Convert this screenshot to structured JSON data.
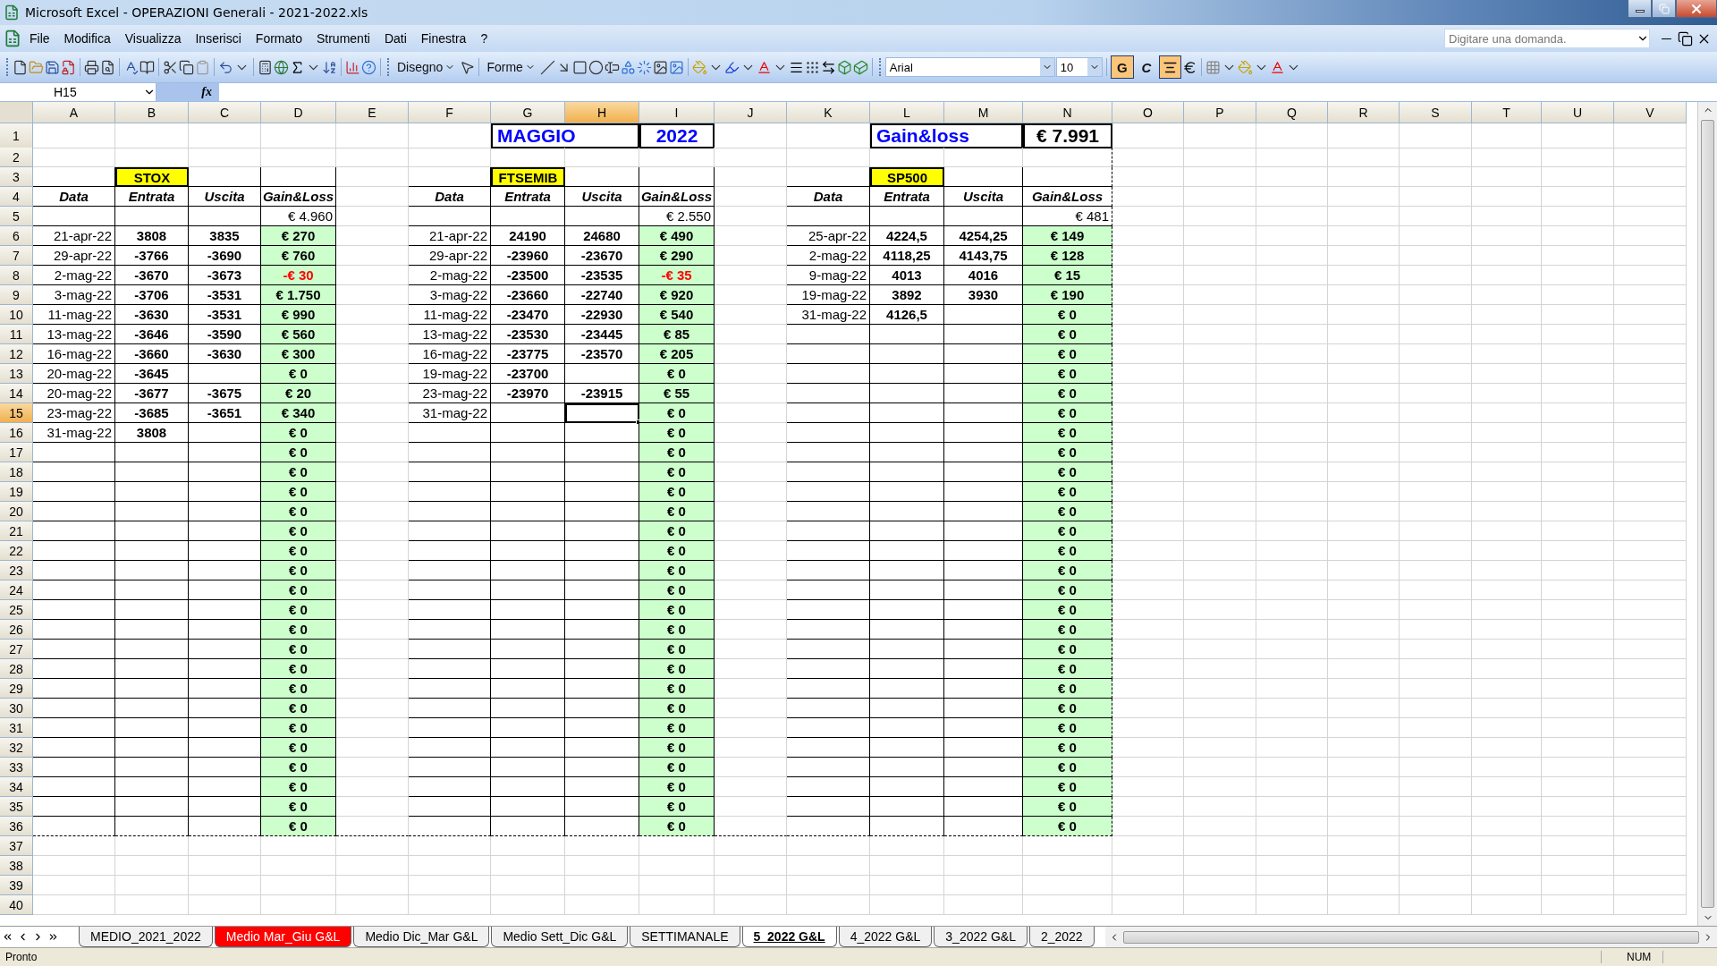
{
  "window": {
    "title": "Microsoft Excel - OPERAZIONI Generali - 2021-2022.xls"
  },
  "menu": [
    "File",
    "Modifica",
    "Visualizza",
    "Inserisci",
    "Formato",
    "Strumenti",
    "Dati",
    "Finestra",
    "?"
  ],
  "help_box": {
    "placeholder": "Digitare una domanda."
  },
  "drawing_toolbar": {
    "draw_menu": "Disegno",
    "shapes_menu": "Forme"
  },
  "format_toolbar": {
    "font": "Arial",
    "size": "10",
    "buttons": [
      {
        "kind": "bold",
        "label": "G",
        "selected": true
      },
      {
        "kind": "italic",
        "label": "C",
        "selected": false
      },
      {
        "kind": "align",
        "selected": true
      }
    ]
  },
  "formula_bar": {
    "name_box": "H15",
    "function_label": "fx"
  },
  "columns": [
    {
      "label": "A",
      "selected": false
    },
    {
      "label": "B",
      "selected": false
    },
    {
      "label": "C",
      "selected": false
    },
    {
      "label": "D",
      "selected": false
    },
    {
      "label": "E",
      "selected": false
    },
    {
      "label": "F",
      "selected": false
    },
    {
      "label": "G",
      "selected": false
    },
    {
      "label": "H",
      "selected": true
    },
    {
      "label": "I",
      "selected": false
    },
    {
      "label": "J",
      "selected": false
    },
    {
      "label": "K",
      "selected": false
    },
    {
      "label": "L",
      "selected": false
    },
    {
      "label": "M",
      "selected": false
    },
    {
      "label": "N",
      "selected": false
    },
    {
      "label": "O",
      "selected": false
    },
    {
      "label": "P",
      "selected": false
    },
    {
      "label": "Q",
      "selected": false
    },
    {
      "label": "R",
      "selected": false
    },
    {
      "label": "S",
      "selected": false
    },
    {
      "label": "T",
      "selected": false
    },
    {
      "label": "U",
      "selected": false
    },
    {
      "label": "V",
      "selected": false
    }
  ],
  "rows": [
    {
      "label": "1",
      "selected": false,
      "cells": {
        "G": {
          "kind": "title",
          "text": "MAGGIO"
        },
        "I": {
          "kind": "title-value",
          "text": "2022"
        },
        "L": {
          "kind": "title",
          "text": "Gain&loss"
        },
        "N": {
          "kind": "total",
          "text": "€ 7.991"
        }
      }
    },
    {
      "label": "2",
      "selected": false,
      "cells": {}
    },
    {
      "label": "3",
      "selected": false,
      "cells": {
        "B": {
          "kind": "tag",
          "text": "STOX"
        },
        "G": {
          "kind": "tag",
          "text": "FTSEMIB"
        },
        "L": {
          "kind": "tag",
          "text": "SP500"
        }
      }
    },
    {
      "label": "4",
      "selected": false,
      "cells": {
        "A": {
          "kind": "header",
          "text": "Data"
        },
        "B": {
          "kind": "header",
          "text": "Entrata"
        },
        "C": {
          "kind": "header",
          "text": "Uscita"
        },
        "D": {
          "kind": "header",
          "text": "Gain&Loss"
        },
        "F": {
          "kind": "header",
          "text": "Data"
        },
        "G": {
          "kind": "header",
          "text": "Entrata"
        },
        "H": {
          "kind": "header",
          "text": "Uscita"
        },
        "I": {
          "kind": "header",
          "text": "Gain&Loss"
        },
        "K": {
          "kind": "header",
          "text": "Data"
        },
        "L": {
          "kind": "header",
          "text": "Entrata"
        },
        "M": {
          "kind": "header",
          "text": "Uscita"
        },
        "N": {
          "kind": "header",
          "text": "Gain&Loss"
        }
      }
    },
    {
      "label": "5",
      "selected": false,
      "cells": {
        "D": {
          "kind": "sum",
          "text": "€ 4.960"
        },
        "I": {
          "kind": "sum",
          "text": "€ 2.550"
        },
        "N": {
          "kind": "sum",
          "text": "€ 481"
        }
      }
    },
    {
      "label": "6",
      "selected": false,
      "cells": {
        "A": {
          "kind": "date",
          "text": "21-apr-22"
        },
        "B": {
          "kind": "num",
          "text": "3808"
        },
        "C": {
          "kind": "num",
          "text": "3835"
        },
        "D": {
          "kind": "gain",
          "text": "€ 270"
        },
        "F": {
          "kind": "date",
          "text": "21-apr-22"
        },
        "G": {
          "kind": "num",
          "text": "24190"
        },
        "H": {
          "kind": "num",
          "text": "24680"
        },
        "I": {
          "kind": "gain",
          "text": "€ 490"
        },
        "K": {
          "kind": "date",
          "text": "25-apr-22"
        },
        "L": {
          "kind": "num",
          "text": "4224,5"
        },
        "M": {
          "kind": "num",
          "text": "4254,25"
        },
        "N": {
          "kind": "gain",
          "text": "€ 149"
        }
      }
    },
    {
      "label": "7",
      "selected": false,
      "cells": {
        "A": {
          "kind": "date",
          "text": "29-apr-22"
        },
        "B": {
          "kind": "num",
          "text": "-3766"
        },
        "C": {
          "kind": "num",
          "text": "-3690"
        },
        "D": {
          "kind": "gain",
          "text": "€ 760"
        },
        "F": {
          "kind": "date",
          "text": "29-apr-22"
        },
        "G": {
          "kind": "num",
          "text": "-23960"
        },
        "H": {
          "kind": "num",
          "text": "-23670"
        },
        "I": {
          "kind": "gain",
          "text": "€ 290"
        },
        "K": {
          "kind": "date",
          "text": "2-mag-22"
        },
        "L": {
          "kind": "num",
          "text": "4118,25"
        },
        "M": {
          "kind": "num",
          "text": "4143,75"
        },
        "N": {
          "kind": "gain",
          "text": "€ 128"
        }
      }
    },
    {
      "label": "8",
      "selected": false,
      "cells": {
        "A": {
          "kind": "date",
          "text": "2-mag-22"
        },
        "B": {
          "kind": "num",
          "text": "-3670"
        },
        "C": {
          "kind": "num",
          "text": "-3673"
        },
        "D": {
          "kind": "loss",
          "text": "-€ 30"
        },
        "F": {
          "kind": "date",
          "text": "2-mag-22"
        },
        "G": {
          "kind": "num",
          "text": "-23500"
        },
        "H": {
          "kind": "num",
          "text": "-23535"
        },
        "I": {
          "kind": "loss",
          "text": "-€ 35"
        },
        "K": {
          "kind": "date",
          "text": "9-mag-22"
        },
        "L": {
          "kind": "num",
          "text": "4013"
        },
        "M": {
          "kind": "num",
          "text": "4016"
        },
        "N": {
          "kind": "gain",
          "text": "€ 15"
        }
      }
    },
    {
      "label": "9",
      "selected": false,
      "cells": {
        "A": {
          "kind": "date",
          "text": "3-mag-22"
        },
        "B": {
          "kind": "num",
          "text": "-3706"
        },
        "C": {
          "kind": "num",
          "text": "-3531"
        },
        "D": {
          "kind": "gain",
          "text": "€ 1.750"
        },
        "F": {
          "kind": "date",
          "text": "3-mag-22"
        },
        "G": {
          "kind": "num",
          "text": "-23660"
        },
        "H": {
          "kind": "num",
          "text": "-22740"
        },
        "I": {
          "kind": "gain",
          "text": "€ 920"
        },
        "K": {
          "kind": "date",
          "text": "19-mag-22"
        },
        "L": {
          "kind": "num",
          "text": "3892"
        },
        "M": {
          "kind": "num",
          "text": "3930"
        },
        "N": {
          "kind": "gain",
          "text": "€ 190"
        }
      }
    },
    {
      "label": "10",
      "selected": false,
      "cells": {
        "A": {
          "kind": "date",
          "text": "11-mag-22"
        },
        "B": {
          "kind": "num",
          "text": "-3630"
        },
        "C": {
          "kind": "num",
          "text": "-3531"
        },
        "D": {
          "kind": "gain",
          "text": "€ 990"
        },
        "F": {
          "kind": "date",
          "text": "11-mag-22"
        },
        "G": {
          "kind": "num",
          "text": "-23470"
        },
        "H": {
          "kind": "num",
          "text": "-22930"
        },
        "I": {
          "kind": "gain",
          "text": "€ 540"
        },
        "K": {
          "kind": "date",
          "text": "31-mag-22"
        },
        "L": {
          "kind": "num",
          "text": "4126,5"
        },
        "N": {
          "kind": "gain",
          "text": "€ 0"
        }
      }
    },
    {
      "label": "11",
      "selected": false,
      "cells": {
        "A": {
          "kind": "date",
          "text": "13-mag-22"
        },
        "B": {
          "kind": "num",
          "text": "-3646"
        },
        "C": {
          "kind": "num",
          "text": "-3590"
        },
        "D": {
          "kind": "gain",
          "text": "€ 560"
        },
        "F": {
          "kind": "date",
          "text": "13-mag-22"
        },
        "G": {
          "kind": "num",
          "text": "-23530"
        },
        "H": {
          "kind": "num",
          "text": "-23445"
        },
        "I": {
          "kind": "gain",
          "text": "€ 85"
        },
        "N": {
          "kind": "gain",
          "text": "€ 0"
        }
      }
    },
    {
      "label": "12",
      "selected": false,
      "cells": {
        "A": {
          "kind": "date",
          "text": "16-mag-22"
        },
        "B": {
          "kind": "num",
          "text": "-3660"
        },
        "C": {
          "kind": "num",
          "text": "-3630"
        },
        "D": {
          "kind": "gain",
          "text": "€ 300"
        },
        "F": {
          "kind": "date",
          "text": "16-mag-22"
        },
        "G": {
          "kind": "num",
          "text": "-23775"
        },
        "H": {
          "kind": "num",
          "text": "-23570"
        },
        "I": {
          "kind": "gain",
          "text": "€ 205"
        },
        "N": {
          "kind": "gain",
          "text": "€ 0"
        }
      }
    },
    {
      "label": "13",
      "selected": false,
      "cells": {
        "A": {
          "kind": "date",
          "text": "20-mag-22"
        },
        "B": {
          "kind": "num",
          "text": "-3645"
        },
        "D": {
          "kind": "gain",
          "text": "€ 0"
        },
        "F": {
          "kind": "date",
          "text": "19-mag-22"
        },
        "G": {
          "kind": "num",
          "text": "-23700"
        },
        "I": {
          "kind": "gain",
          "text": "€ 0"
        },
        "N": {
          "kind": "gain",
          "text": "€ 0"
        }
      }
    },
    {
      "label": "14",
      "selected": false,
      "cells": {
        "A": {
          "kind": "date",
          "text": "20-mag-22"
        },
        "B": {
          "kind": "num",
          "text": "-3677"
        },
        "C": {
          "kind": "num",
          "text": "-3675"
        },
        "D": {
          "kind": "gain",
          "text": "€ 20"
        },
        "F": {
          "kind": "date",
          "text": "23-mag-22"
        },
        "G": {
          "kind": "num",
          "text": "-23970"
        },
        "H": {
          "kind": "num",
          "text": "-23915"
        },
        "I": {
          "kind": "gain",
          "text": "€ 55"
        },
        "N": {
          "kind": "gain",
          "text": "€ 0"
        }
      }
    },
    {
      "label": "15",
      "selected": true,
      "cells": {
        "A": {
          "kind": "date",
          "text": "23-mag-22"
        },
        "B": {
          "kind": "num",
          "text": "-3685"
        },
        "C": {
          "kind": "num",
          "text": "-3651"
        },
        "D": {
          "kind": "gain",
          "text": "€ 340"
        },
        "F": {
          "kind": "date",
          "text": "31-mag-22"
        },
        "I": {
          "kind": "gain",
          "text": "€ 0"
        },
        "N": {
          "kind": "gain",
          "text": "€ 0"
        }
      }
    },
    {
      "label": "16",
      "selected": false,
      "cells": {
        "A": {
          "kind": "date",
          "text": "31-mag-22"
        },
        "B": {
          "kind": "num",
          "text": "3808"
        },
        "D": {
          "kind": "gain",
          "text": "€ 0"
        },
        "I": {
          "kind": "gain",
          "text": "€ 0"
        },
        "N": {
          "kind": "gain",
          "text": "€ 0"
        }
      }
    },
    {
      "label": "17",
      "selected": false,
      "cells": {
        "D": {
          "kind": "gain",
          "text": "€ 0"
        },
        "I": {
          "kind": "gain",
          "text": "€ 0"
        },
        "N": {
          "kind": "gain",
          "text": "€ 0"
        }
      }
    },
    {
      "label": "18",
      "selected": false,
      "cells": {
        "D": {
          "kind": "gain",
          "text": "€ 0"
        },
        "I": {
          "kind": "gain",
          "text": "€ 0"
        },
        "N": {
          "kind": "gain",
          "text": "€ 0"
        }
      }
    },
    {
      "label": "19",
      "selected": false,
      "cells": {
        "D": {
          "kind": "gain",
          "text": "€ 0"
        },
        "I": {
          "kind": "gain",
          "text": "€ 0"
        },
        "N": {
          "kind": "gain",
          "text": "€ 0"
        }
      }
    },
    {
      "label": "20",
      "selected": false,
      "cells": {
        "D": {
          "kind": "gain",
          "text": "€ 0"
        },
        "I": {
          "kind": "gain",
          "text": "€ 0"
        },
        "N": {
          "kind": "gain",
          "text": "€ 0"
        }
      }
    },
    {
      "label": "21",
      "selected": false,
      "cells": {
        "D": {
          "kind": "gain",
          "text": "€ 0"
        },
        "I": {
          "kind": "gain",
          "text": "€ 0"
        },
        "N": {
          "kind": "gain",
          "text": "€ 0"
        }
      }
    },
    {
      "label": "22",
      "selected": false,
      "cells": {
        "D": {
          "kind": "gain",
          "text": "€ 0"
        },
        "I": {
          "kind": "gain",
          "text": "€ 0"
        },
        "N": {
          "kind": "gain",
          "text": "€ 0"
        }
      }
    },
    {
      "label": "23",
      "selected": false,
      "cells": {
        "D": {
          "kind": "gain",
          "text": "€ 0"
        },
        "I": {
          "kind": "gain",
          "text": "€ 0"
        },
        "N": {
          "kind": "gain",
          "text": "€ 0"
        }
      }
    },
    {
      "label": "24",
      "selected": false,
      "cells": {
        "D": {
          "kind": "gain",
          "text": "€ 0"
        },
        "I": {
          "kind": "gain",
          "text": "€ 0"
        },
        "N": {
          "kind": "gain",
          "text": "€ 0"
        }
      }
    },
    {
      "label": "25",
      "selected": false,
      "cells": {
        "D": {
          "kind": "gain",
          "text": "€ 0"
        },
        "I": {
          "kind": "gain",
          "text": "€ 0"
        },
        "N": {
          "kind": "gain",
          "text": "€ 0"
        }
      }
    },
    {
      "label": "26",
      "selected": false,
      "cells": {
        "D": {
          "kind": "gain",
          "text": "€ 0"
        },
        "I": {
          "kind": "gain",
          "text": "€ 0"
        },
        "N": {
          "kind": "gain",
          "text": "€ 0"
        }
      }
    },
    {
      "label": "27",
      "selected": false,
      "cells": {
        "D": {
          "kind": "gain",
          "text": "€ 0"
        },
        "I": {
          "kind": "gain",
          "text": "€ 0"
        },
        "N": {
          "kind": "gain",
          "text": "€ 0"
        }
      }
    },
    {
      "label": "28",
      "selected": false,
      "cells": {
        "D": {
          "kind": "gain",
          "text": "€ 0"
        },
        "I": {
          "kind": "gain",
          "text": "€ 0"
        },
        "N": {
          "kind": "gain",
          "text": "€ 0"
        }
      }
    },
    {
      "label": "29",
      "selected": false,
      "cells": {
        "D": {
          "kind": "gain",
          "text": "€ 0"
        },
        "I": {
          "kind": "gain",
          "text": "€ 0"
        },
        "N": {
          "kind": "gain",
          "text": "€ 0"
        }
      }
    },
    {
      "label": "30",
      "selected": false,
      "cells": {
        "D": {
          "kind": "gain",
          "text": "€ 0"
        },
        "I": {
          "kind": "gain",
          "text": "€ 0"
        },
        "N": {
          "kind": "gain",
          "text": "€ 0"
        }
      }
    },
    {
      "label": "31",
      "selected": false,
      "cells": {
        "D": {
          "kind": "gain",
          "text": "€ 0"
        },
        "I": {
          "kind": "gain",
          "text": "€ 0"
        },
        "N": {
          "kind": "gain",
          "text": "€ 0"
        }
      }
    },
    {
      "label": "32",
      "selected": false,
      "cells": {
        "D": {
          "kind": "gain",
          "text": "€ 0"
        },
        "I": {
          "kind": "gain",
          "text": "€ 0"
        },
        "N": {
          "kind": "gain",
          "text": "€ 0"
        }
      }
    },
    {
      "label": "33",
      "selected": false,
      "cells": {
        "D": {
          "kind": "gain",
          "text": "€ 0"
        },
        "I": {
          "kind": "gain",
          "text": "€ 0"
        },
        "N": {
          "kind": "gain",
          "text": "€ 0"
        }
      }
    },
    {
      "label": "34",
      "selected": false,
      "cells": {
        "D": {
          "kind": "gain",
          "text": "€ 0"
        },
        "I": {
          "kind": "gain",
          "text": "€ 0"
        },
        "N": {
          "kind": "gain",
          "text": "€ 0"
        }
      }
    },
    {
      "label": "35",
      "selected": false,
      "cells": {
        "D": {
          "kind": "gain",
          "text": "€ 0"
        },
        "I": {
          "kind": "gain",
          "text": "€ 0"
        },
        "N": {
          "kind": "gain",
          "text": "€ 0"
        }
      }
    },
    {
      "label": "36",
      "selected": false,
      "cells": {
        "D": {
          "kind": "gain",
          "text": "€ 0"
        },
        "I": {
          "kind": "gain",
          "text": "€ 0"
        },
        "N": {
          "kind": "gain",
          "text": "€ 0"
        }
      }
    },
    {
      "label": "37",
      "selected": false,
      "cells": {}
    },
    {
      "label": "38",
      "selected": false,
      "cells": {}
    },
    {
      "label": "39",
      "selected": false,
      "cells": {}
    },
    {
      "label": "40",
      "selected": false,
      "cells": {}
    }
  ],
  "sheet_tabs": [
    {
      "label": "MEDIO_2021_2022",
      "selected": false
    },
    {
      "label": "Medio Mar_Giu G&L",
      "selected": false,
      "color": "#ff0000"
    },
    {
      "label": "Medio Dic_Mar G&L",
      "selected": false
    },
    {
      "label": "Medio Sett_Dic G&L",
      "selected": false
    },
    {
      "label": "SETTIMANALE",
      "selected": false
    },
    {
      "label": "5_2022 G&L",
      "selected": true
    },
    {
      "label": "4_2022 G&L",
      "selected": false
    },
    {
      "label": "3_2022 G&L",
      "selected": false
    },
    {
      "label": "2_2022",
      "selected": false
    }
  ],
  "status_bar": {
    "message": "Pronto",
    "indicator": "NUM"
  }
}
